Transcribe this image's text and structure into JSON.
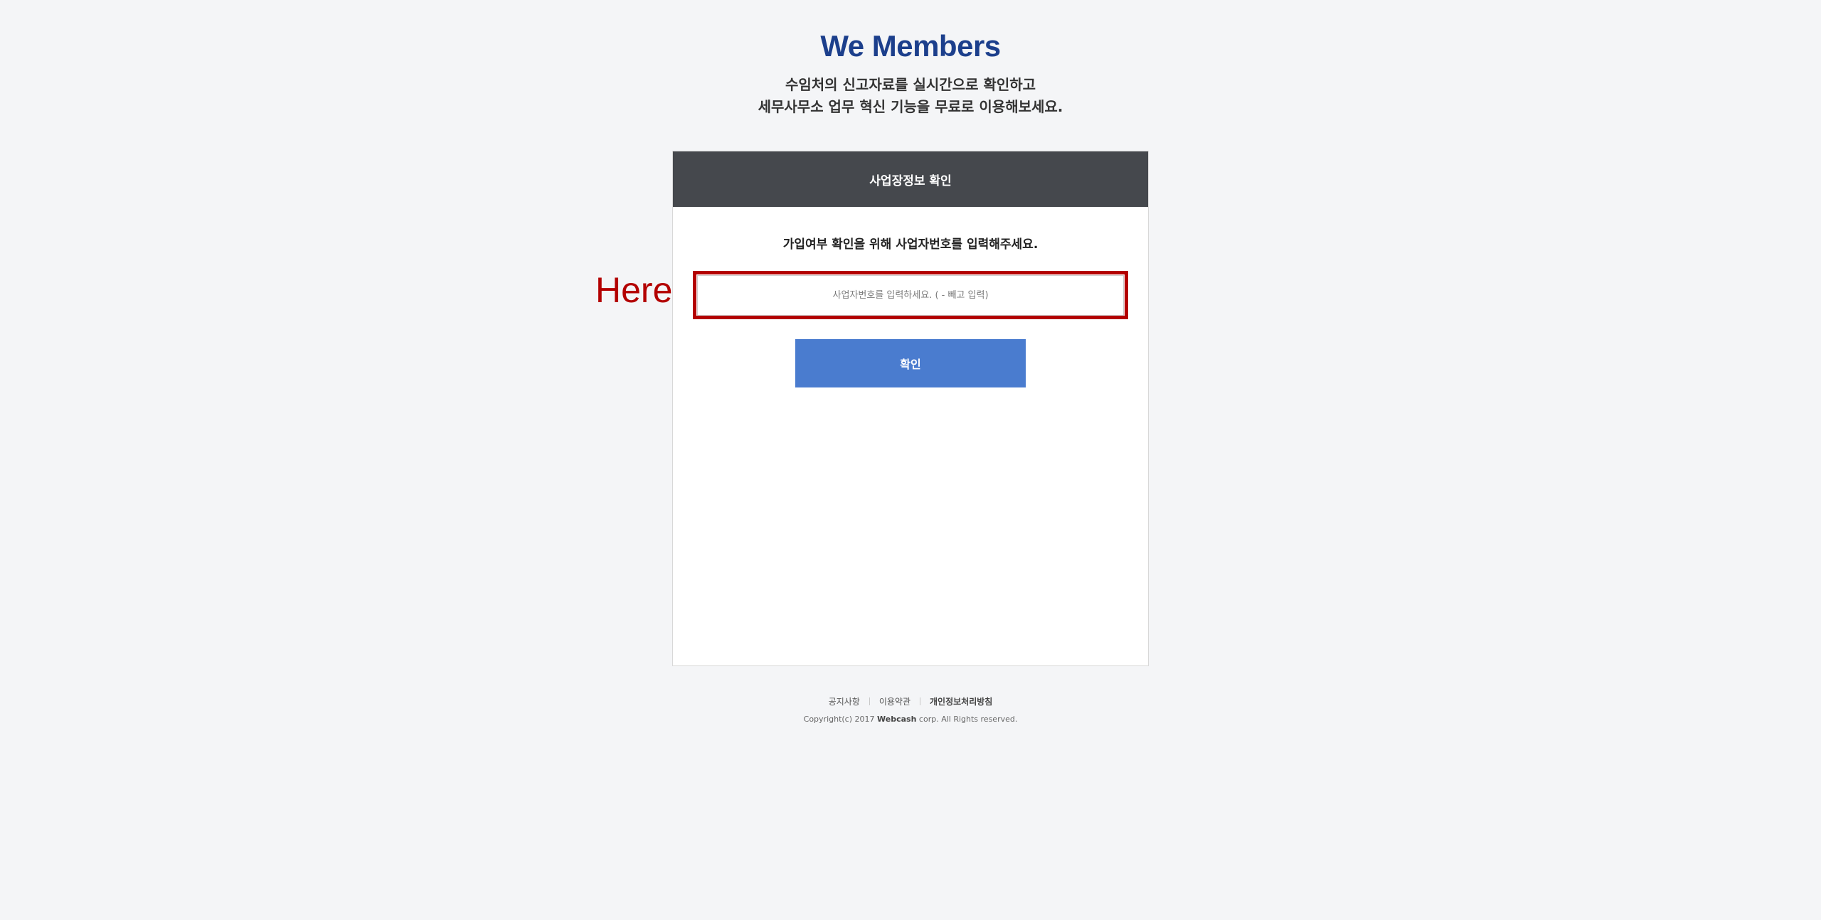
{
  "header": {
    "brand": "We Members",
    "tagline_line1": "수임처의 신고자료를 실시간으로  확인하고",
    "tagline_line2": "세무사무소 업무 혁신 기능을 무료로 이용해보세요."
  },
  "panel": {
    "title": "사업장정보 확인",
    "instruction": "가입여부 확인을 위해 사업자번호를 입력해주세요.",
    "input_value": "",
    "input_placeholder": "사업자번호를 입력하세요. ( - 빼고 입력)",
    "confirm_label": "확인"
  },
  "annotation": {
    "text": "Here!",
    "color": "#b30000"
  },
  "footer": {
    "links": [
      "공지사항",
      "이용약관",
      "개인정보처리방침"
    ],
    "copyright_prefix": "Copyright(c) 2017 ",
    "copyright_company": "Webcash",
    "copyright_suffix": " corp. All Rights reserved."
  },
  "colors": {
    "brand": "#1c3f8c",
    "panel_header": "#45484d",
    "button": "#4a7ccf",
    "background": "#f4f5f7"
  }
}
